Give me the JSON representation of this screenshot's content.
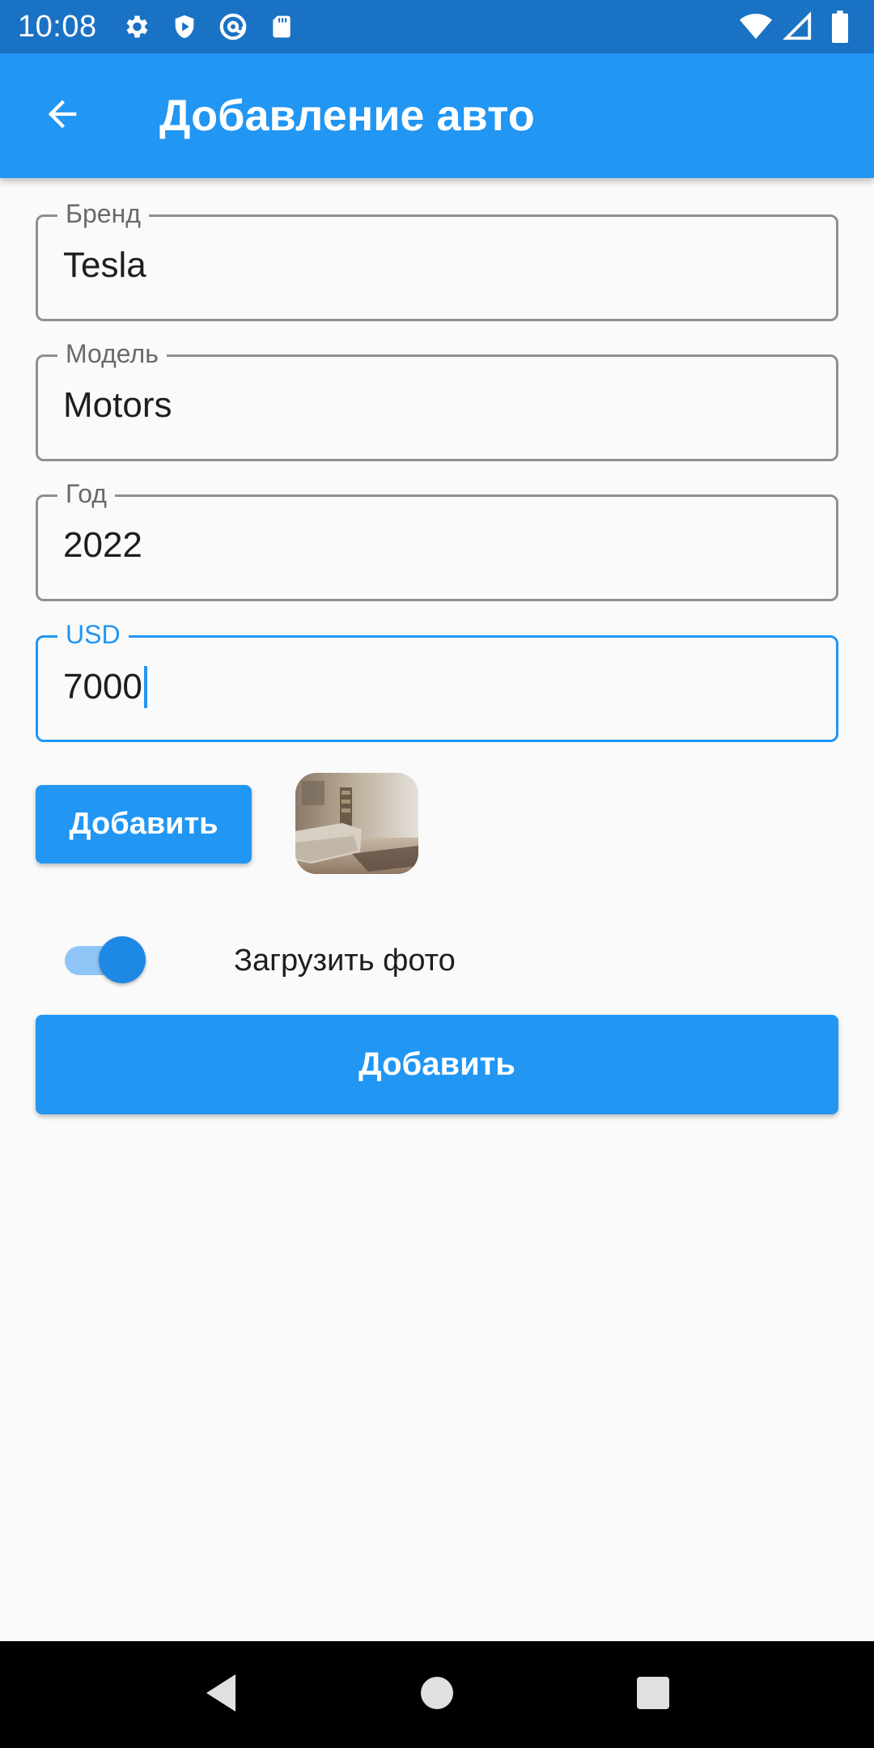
{
  "status_bar": {
    "time": "10:08",
    "icons_left": [
      "settings-icon",
      "shield-play-icon",
      "at-sign-icon",
      "sd-card-icon"
    ],
    "icons_right": [
      "wifi-icon",
      "signal-icon",
      "battery-icon"
    ]
  },
  "app_bar": {
    "title": "Добавление авто",
    "back_icon": "arrow-back-icon"
  },
  "form": {
    "brand": {
      "label": "Бренд",
      "value": "Tesla"
    },
    "model": {
      "label": "Модель",
      "value": "Motors"
    },
    "year": {
      "label": "Год",
      "value": "2022"
    },
    "price": {
      "label": "USD",
      "value": "7000",
      "focused": true
    }
  },
  "add_photo_button": {
    "label": "Добавить"
  },
  "photo_thumbnail": {
    "description_icon": "photo-thumbnail"
  },
  "upload_toggle": {
    "label": "Загрузить фото",
    "on": true
  },
  "submit_button": {
    "label": "Добавить"
  },
  "colors": {
    "primary": "#2196f3",
    "status_bar": "#1a72c4",
    "background": "#fafafa",
    "outline": "#8f8f8f"
  },
  "nav_bar": {
    "buttons": [
      "back-nav-icon",
      "home-nav-icon",
      "recents-nav-icon"
    ]
  }
}
